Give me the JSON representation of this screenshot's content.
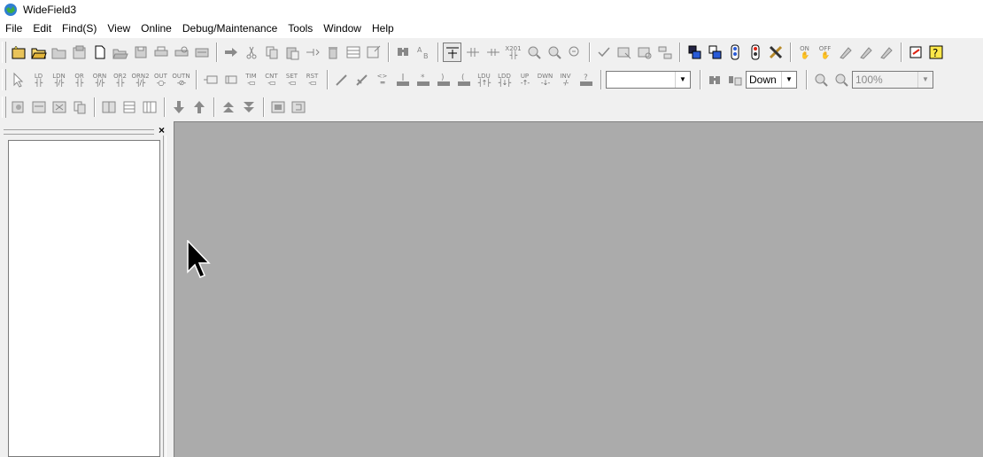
{
  "title": "WideField3",
  "menu": [
    "File",
    "Edit",
    "Find(S)",
    "View",
    "Online",
    "Debug/Maintenance",
    "Tools",
    "Window",
    "Help"
  ],
  "ladder_labels": {
    "ld": "LD",
    "ldn": "LDN",
    "or": "OR",
    "orn": "ORN",
    "or2": "OR2",
    "orn2": "ORN2",
    "out": "OUT",
    "outn": "OUTN",
    "tim": "TIM",
    "cnt": "CNT",
    "set": "SET",
    "rst": "RST",
    "xor": "<>",
    "ldu": "LDU",
    "ldd": "LDD",
    "up": "UP",
    "dwn": "DWN",
    "inv": "INV",
    "x201": "X201",
    "on": "ON",
    "off": "OFF"
  },
  "find_combo": {
    "value": ""
  },
  "direction_combo": {
    "value": "Down"
  },
  "zoom_combo": {
    "value": "100%"
  }
}
